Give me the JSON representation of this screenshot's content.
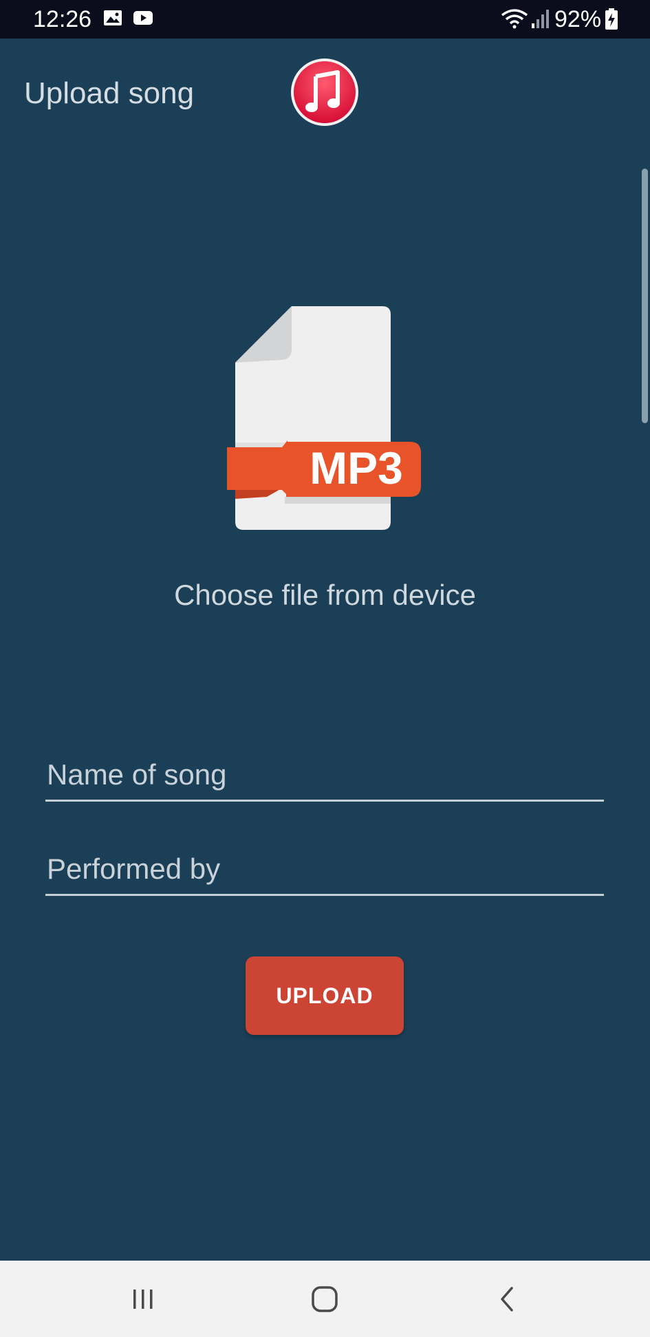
{
  "status_bar": {
    "time": "12:26",
    "battery_percent": "92%",
    "icons": [
      "image-icon",
      "youtube-icon",
      "wifi-icon",
      "signal-icon",
      "battery-charging-icon"
    ]
  },
  "header": {
    "title": "Upload song",
    "logo_icon": "music-note-icon",
    "logo_color": "#e8123c"
  },
  "file_picker": {
    "icon": "mp3-file-icon",
    "badge_text": "MP3",
    "badge_color": "#e8532a",
    "choose_label": "Choose file from device"
  },
  "form": {
    "song_name_placeholder": "Name of song",
    "song_name_value": "",
    "performer_placeholder": "Performed by",
    "performer_value": "",
    "upload_label": "UPLOAD",
    "upload_color": "#cc4434"
  },
  "nav_bar": {
    "buttons": [
      "recent-apps-icon",
      "home-icon",
      "back-icon"
    ]
  }
}
